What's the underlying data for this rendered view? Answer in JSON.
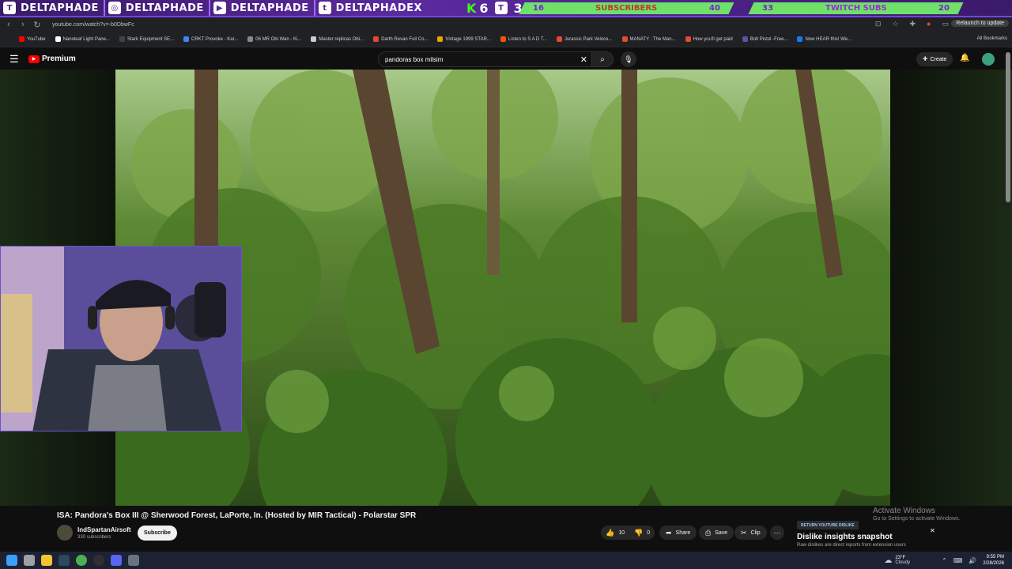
{
  "overlay": {
    "handles": [
      {
        "icon": "twitch-icon",
        "name": "DELTAPHADE"
      },
      {
        "icon": "instagram-icon",
        "name": "DELTAPHADE"
      },
      {
        "icon": "youtube-icon",
        "name": "DELTAPHADE"
      },
      {
        "icon": "twitter-icon",
        "name": "DELTAPHADEX"
      }
    ],
    "k_label": "K",
    "count_a": "6",
    "count_b": "3",
    "subs_bar": {
      "left": "16",
      "label": "SUBSCRIBERS",
      "right": "40"
    },
    "twitch_bar": {
      "left": "33",
      "label": "TWITCH SUBS",
      "right": "20"
    }
  },
  "browser": {
    "url": "youtube.com/watch?v=-b0DbwFc",
    "relaunch": "Relaunch to update",
    "bookmarks": [
      {
        "label": "YouTube",
        "color": "#ff0000"
      },
      {
        "label": "Nanoleaf Light Pane...",
        "color": "#ffffff"
      },
      {
        "label": "Stark Equipment SE...",
        "color": "#444444"
      },
      {
        "label": "CRKT Provoke - Kar...",
        "color": "#4285f4"
      },
      {
        "label": "06 MR Obi Wan - Ki...",
        "color": "#888888"
      },
      {
        "label": "Master replicas Obi...",
        "color": "#cccccc"
      },
      {
        "label": "Darth Revan Full Co...",
        "color": "#e34a2f"
      },
      {
        "label": "Vintage 1999 STAR...",
        "color": "#e8a500"
      },
      {
        "label": "Listen to S A D T...",
        "color": "#ff5500"
      },
      {
        "label": "Jurassic Park Veloce...",
        "color": "#e34a2f"
      },
      {
        "label": "MANATY : The Man...",
        "color": "#e34a2f"
      },
      {
        "label": "How you'll get paid",
        "color": "#e34a2f"
      },
      {
        "label": "Bolt Pistol -Free...",
        "color": "#5555aa"
      },
      {
        "label": "Now HEAR this! We...",
        "color": "#1877f2"
      }
    ],
    "all_bookmarks": "All Bookmarks"
  },
  "youtube": {
    "logo": "Premium",
    "search": "pandoras box milsim",
    "create": "Create",
    "video_title": "ISA: Pandora's Box III @ Sherwood Forest, LaPorte, In. (Hosted by MIR Tactical) - Polarstar SPR",
    "channel": "IndSpartanAirsoft",
    "subscribers": "330 subscribers",
    "subscribe": "Subscribe",
    "likes": "10",
    "dislikes": "0",
    "share": "Share",
    "save": "Save",
    "clip": "Clip"
  },
  "extension": {
    "badge": "RETURN YOUTUBE DISLIKE",
    "title": "Dislike insights snapshot",
    "subtitle": "Raw dislikes are direct reports from extension users"
  },
  "watermark": {
    "line1": "Activate Windows",
    "line2": "Go to Settings to activate Windows."
  },
  "taskbar": {
    "temp": "23°F",
    "weather": "Cloudy",
    "time": "9:55 PM",
    "date": "2/28/2026"
  }
}
